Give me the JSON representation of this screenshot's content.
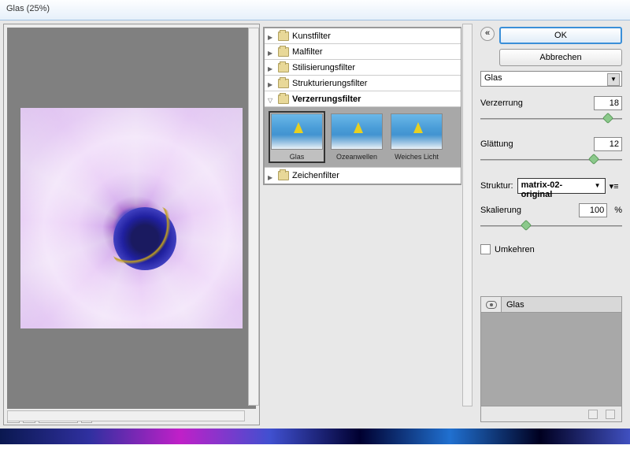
{
  "title": "Glas (25%)",
  "zoom": {
    "value": "25%",
    "minus": "−",
    "plus": "+"
  },
  "categories": [
    {
      "label": "Kunstfilter",
      "expanded": false
    },
    {
      "label": "Malfilter",
      "expanded": false
    },
    {
      "label": "Stilisierungsfilter",
      "expanded": false
    },
    {
      "label": "Strukturierungsfilter",
      "expanded": false
    },
    {
      "label": "Verzerrungsfilter",
      "expanded": true
    },
    {
      "label": "Zeichenfilter",
      "expanded": false
    }
  ],
  "thumbs": [
    {
      "label": "Glas",
      "selected": true
    },
    {
      "label": "Ozeanwellen",
      "selected": false
    },
    {
      "label": "Weiches Licht",
      "selected": false
    }
  ],
  "buttons": {
    "ok": "OK",
    "cancel": "Abbrechen",
    "collapse": "«"
  },
  "filter_select": "Glas",
  "params": {
    "verzerrung": {
      "label": "Verzerrung",
      "value": "18",
      "pos": 90
    },
    "glaettung": {
      "label": "Glättung",
      "value": "12",
      "pos": 80
    },
    "struktur_label": "Struktur:",
    "struktur_value": "matrix-02-original",
    "skalierung": {
      "label": "Skalierung",
      "value": "100",
      "unit": "%",
      "pos": 32
    },
    "umkehren": "Umkehren"
  },
  "layer": {
    "name": "Glas"
  }
}
